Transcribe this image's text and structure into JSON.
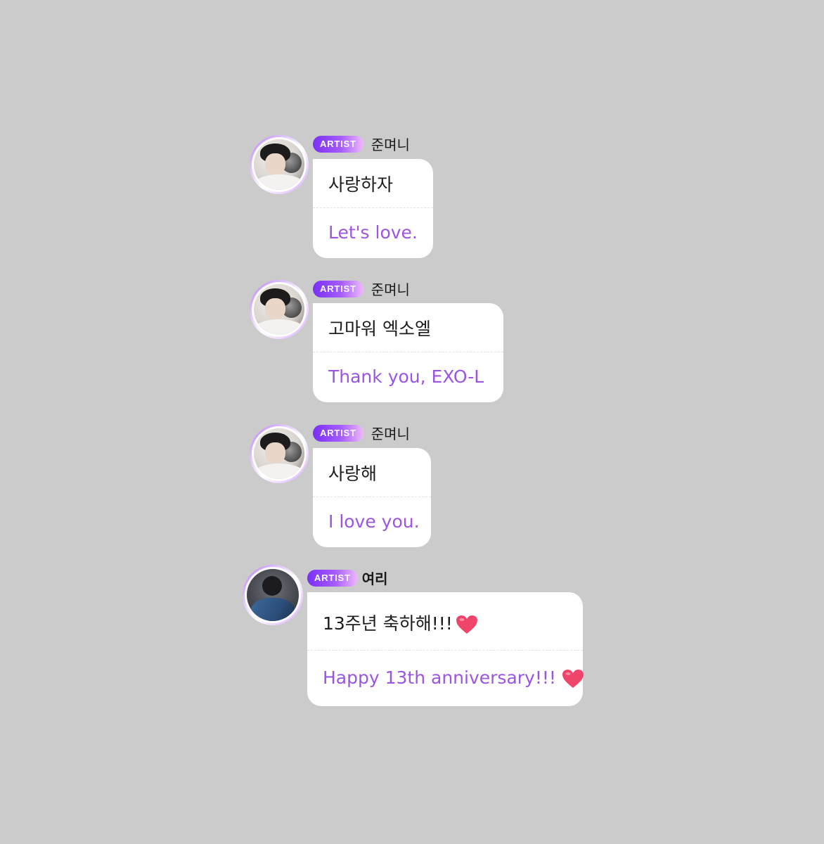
{
  "colors": {
    "background": "#cbcbcb",
    "bubble": "#ffffff",
    "translation_text": "#9b55e3",
    "badge_start": "#7b2ff7",
    "badge_end": "#f0b8ff",
    "heart": "#f0456b"
  },
  "messages": [
    {
      "badge": "ARTIST",
      "sender": "준며니",
      "text": "사랑하자",
      "translation": "Let's love."
    },
    {
      "badge": "ARTIST",
      "sender": "준며니",
      "text": "고마워 엑소엘",
      "translation": "Thank you, EXO-L"
    },
    {
      "badge": "ARTIST",
      "sender": "준며니",
      "text": "사랑해",
      "translation": "I love you."
    },
    {
      "badge": "ARTIST",
      "sender": "여리",
      "text": "13주년 축하해!!!",
      "text_icon": "heart-icon",
      "translation": "Happy 13th anniversary!!!",
      "translation_icon": "heart-icon"
    }
  ]
}
